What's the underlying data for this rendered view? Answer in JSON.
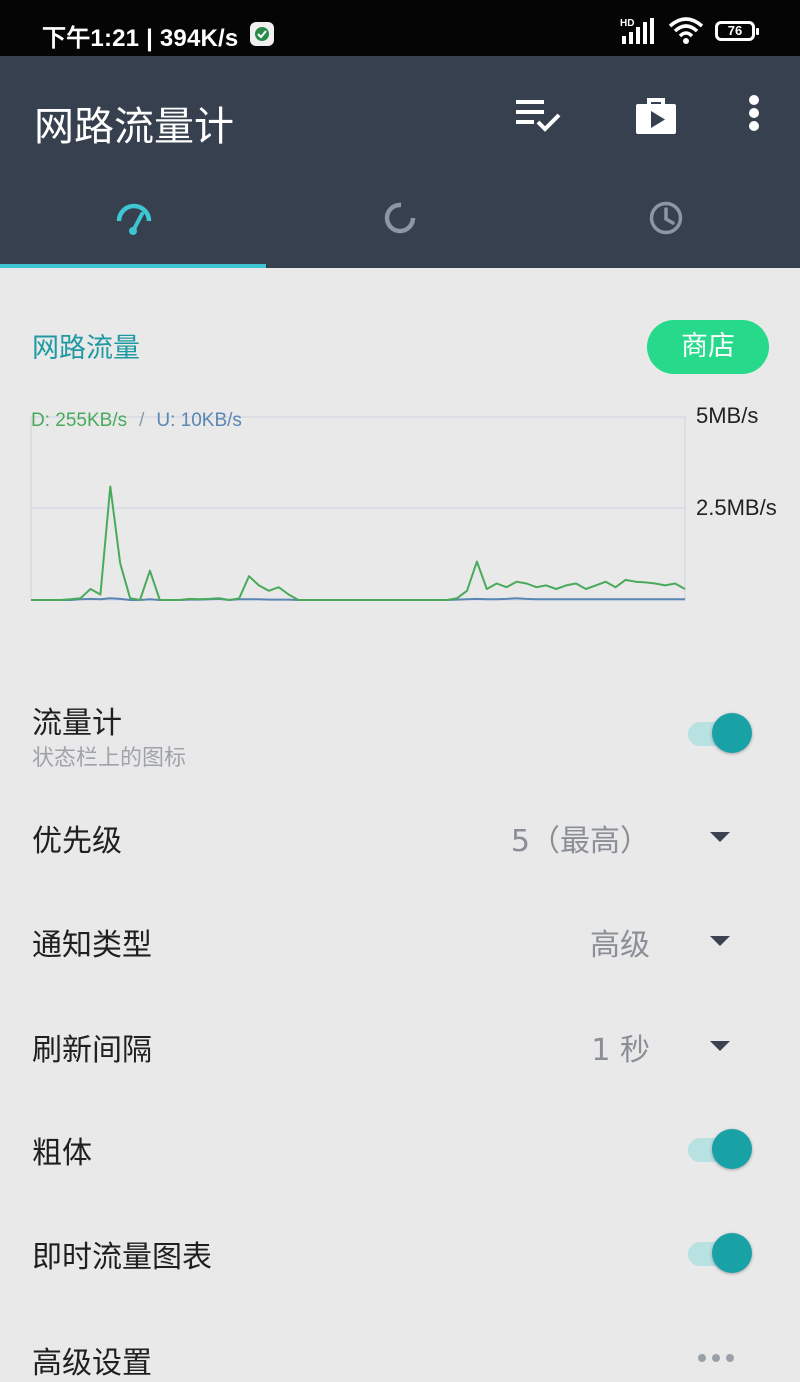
{
  "status_bar": {
    "time": "下午1:21 | 394K/s",
    "signal_label": "HD",
    "battery": "76"
  },
  "app_bar": {
    "title": "网路流量计",
    "actions": [
      "checklist-icon",
      "store-bag-icon",
      "more-vert-icon"
    ]
  },
  "tabs": [
    {
      "icon": "speedometer-icon",
      "selected": true
    },
    {
      "icon": "data-usage-icon",
      "selected": false
    },
    {
      "icon": "history-clock-icon",
      "selected": false
    }
  ],
  "section": {
    "title": "网路流量",
    "store_button": "商店"
  },
  "speed_chart": {
    "download_label": "D: 255KB/s",
    "separator": "/",
    "upload_label": "U: 10KB/s",
    "tick_top": "5MB/s",
    "tick_mid": "2.5MB/s"
  },
  "chart_data": {
    "type": "line",
    "ylim_mb_per_s": [
      0,
      5
    ],
    "y_ticks": [
      "5MB/s",
      "2.5MB/s"
    ],
    "series": [
      {
        "name": "D: 255KB/s",
        "color": "#4aaa5b",
        "values_mb_per_s": [
          0,
          0,
          0,
          0,
          0.02,
          0.05,
          0.3,
          0.15,
          3.1,
          1.0,
          0.05,
          0,
          0.8,
          0,
          0,
          0,
          0.03,
          0.02,
          0.03,
          0.05,
          0,
          0.04,
          0.65,
          0.4,
          0.25,
          0.35,
          0.15,
          0,
          0,
          0,
          0,
          0,
          0,
          0,
          0,
          0,
          0,
          0,
          0,
          0,
          0,
          0,
          0,
          0.05,
          0.25,
          1.05,
          0.3,
          0.45,
          0.35,
          0.5,
          0.45,
          0.35,
          0.4,
          0.3,
          0.4,
          0.45,
          0.3,
          0.4,
          0.5,
          0.35,
          0.55,
          0.5,
          0.48,
          0.45,
          0.4,
          0.45,
          0.3
        ]
      },
      {
        "name": "U: 10KB/s",
        "color": "#5b86b4",
        "values_mb_per_s": [
          0,
          0,
          0,
          0,
          0,
          0.02,
          0.03,
          0.02,
          0.05,
          0.03,
          0,
          0,
          0.02,
          0,
          0,
          0,
          0.01,
          0.01,
          0.02,
          0.03,
          0,
          0.02,
          0.02,
          0.02,
          0.01,
          0.01,
          0.01,
          0,
          0,
          0,
          0,
          0,
          0,
          0,
          0,
          0,
          0,
          0,
          0,
          0,
          0,
          0,
          0,
          0.01,
          0.02,
          0.03,
          0.02,
          0.02,
          0.03,
          0.05,
          0.03,
          0.02,
          0.02,
          0.02,
          0.02,
          0.02,
          0.02,
          0.02,
          0.02,
          0.02,
          0.02,
          0.02,
          0.02,
          0.02,
          0.02,
          0.02,
          0.02
        ]
      }
    ]
  },
  "settings": {
    "meter": {
      "label": "流量计",
      "sub": "状态栏上的图标",
      "toggle": true
    },
    "priority": {
      "label": "优先级",
      "value": "5（最高）"
    },
    "notify_type": {
      "label": "通知类型",
      "value": "高级"
    },
    "refresh": {
      "label": "刷新间隔",
      "value": "1 秒"
    },
    "bold": {
      "label": "粗体",
      "toggle": true
    },
    "live_chart": {
      "label": "即时流量图表",
      "toggle": true
    },
    "advanced": {
      "label": "高级设置"
    }
  }
}
